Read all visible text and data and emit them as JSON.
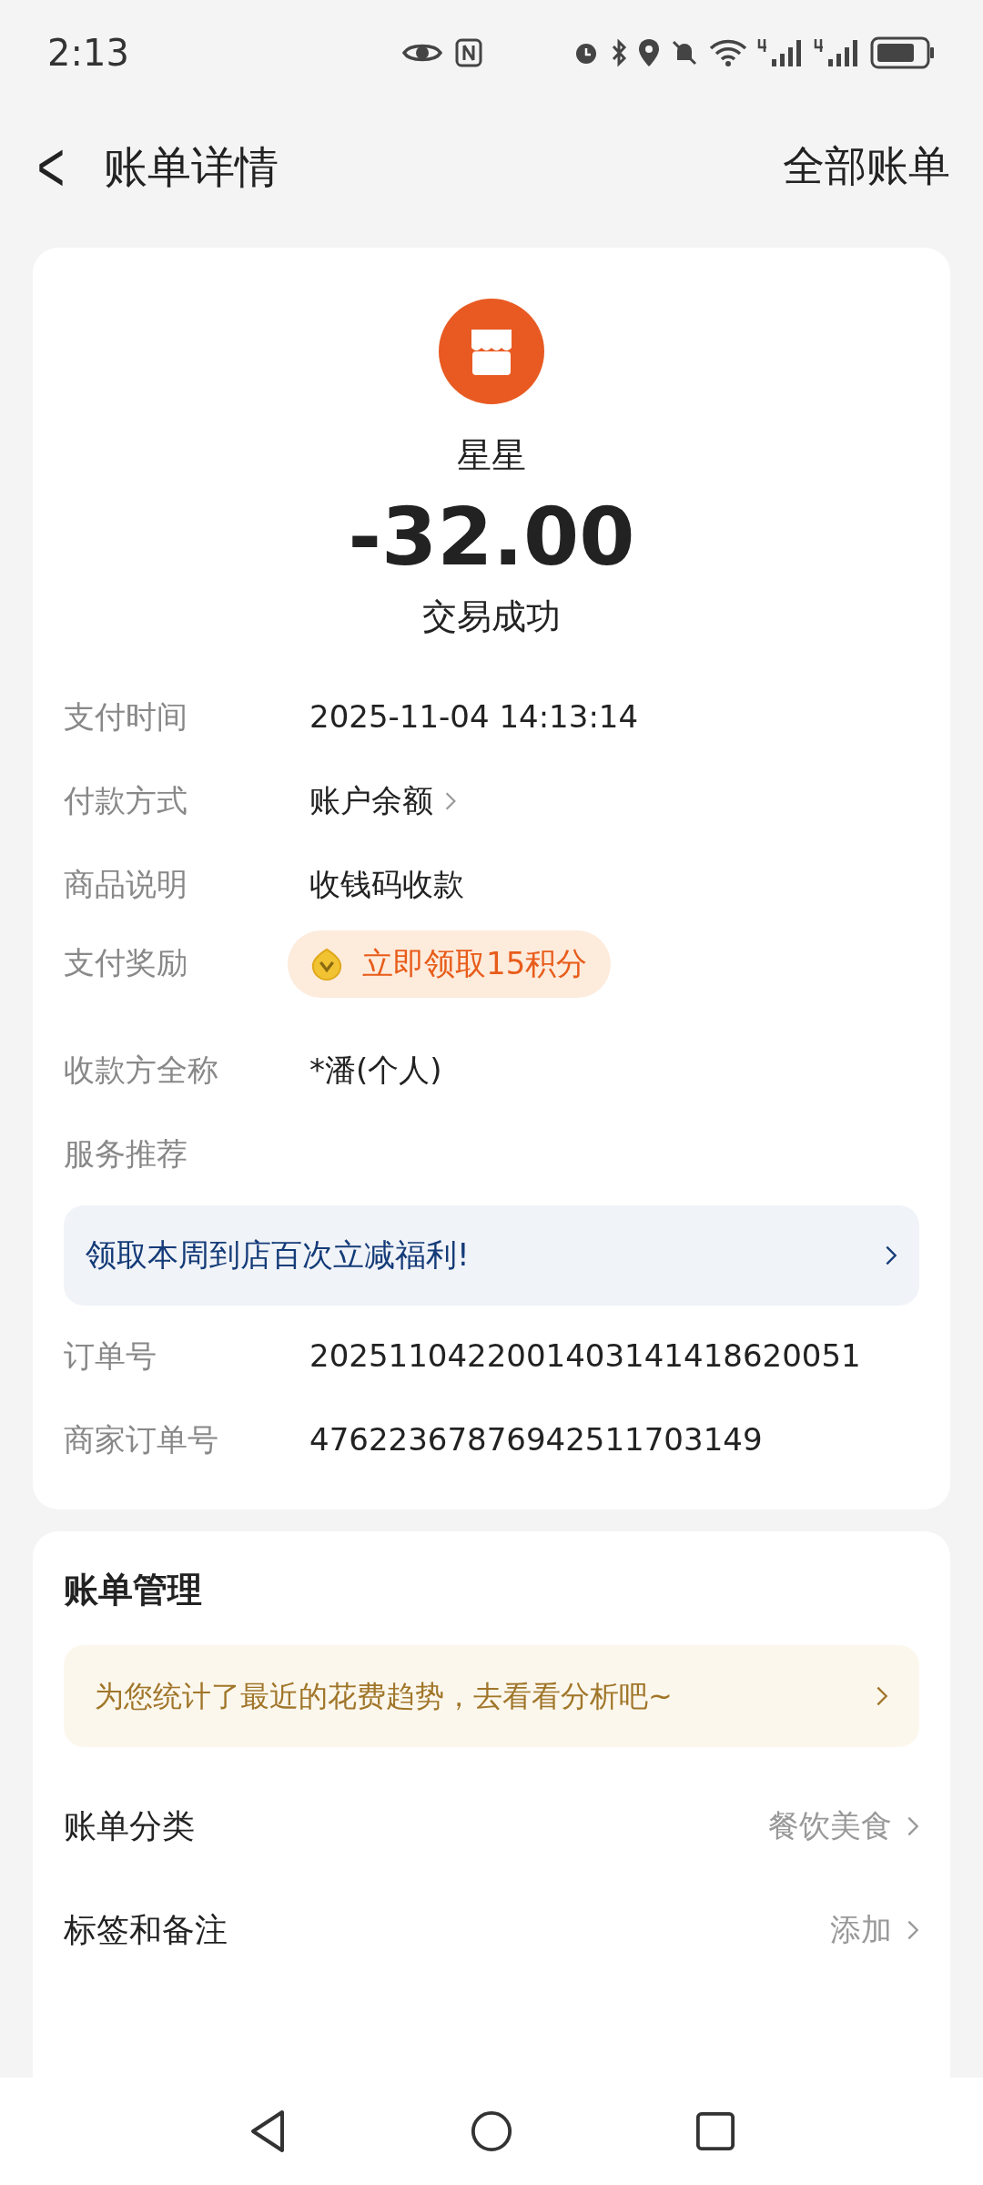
{
  "status_bar": {
    "time": "2:13"
  },
  "header": {
    "back": "<",
    "title": "账单详情",
    "action": "全部账单"
  },
  "transaction": {
    "merchant": "星星",
    "amount": "-32.00",
    "status": "交易成功"
  },
  "details": [
    {
      "kind": "text",
      "label": "支付时间",
      "value": "2025-11-04 14:13:14"
    },
    {
      "kind": "link",
      "label": "付款方式",
      "value": "账户余额"
    },
    {
      "kind": "text",
      "label": "商品说明",
      "value": "收钱码收款"
    },
    {
      "kind": "reward",
      "label": "支付奖励",
      "value": "立即领取15积分"
    },
    {
      "kind": "text",
      "label": "收款方全称",
      "value": "*潘(个人)"
    },
    {
      "kind": "heading",
      "label": "服务推荐"
    },
    {
      "kind": "banner",
      "value": "领取本周到店百次立减福利!"
    },
    {
      "kind": "text",
      "label": "订单号",
      "value": "2025110422001403141418620051"
    },
    {
      "kind": "text",
      "label": "商家订单号",
      "value": "47622367876942511703149"
    }
  ],
  "management": {
    "title": "账单管理",
    "banner": "为您统计了最近的花费趋势，去看看分析吧~",
    "rows": [
      {
        "label": "账单分类",
        "value": "餐饮美食"
      },
      {
        "label": "标签和备注",
        "value": "添加"
      }
    ]
  }
}
